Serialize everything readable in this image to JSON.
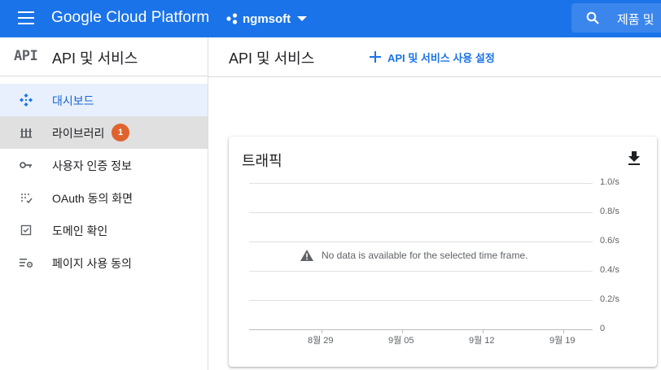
{
  "topbar": {
    "brand": "Google Cloud Platform",
    "project": "ngmsoft",
    "search_text": "제품 및"
  },
  "sidebar": {
    "logo": "API",
    "title": "API 및 서비스",
    "items": [
      {
        "label": "대시보드",
        "icon": "dashboard-icon",
        "active": true
      },
      {
        "label": "라이브러리",
        "icon": "library-icon",
        "badge": "1"
      },
      {
        "label": "사용자 인증 정보",
        "icon": "key-icon"
      },
      {
        "label": "OAuth 동의 화면",
        "icon": "consent-icon"
      },
      {
        "label": "도메인 확인",
        "icon": "checkbox-icon"
      },
      {
        "label": "페이지 사용 동의",
        "icon": "settings-list-icon"
      }
    ]
  },
  "header": {
    "title": "API 및 서비스",
    "enable_label": "API 및 서비스 사용 설정"
  },
  "card": {
    "title": "트래픽",
    "no_data": "No data is available for the selected time frame."
  },
  "chart_data": {
    "type": "line",
    "title": "트래픽",
    "series": [],
    "x_ticks": [
      "8월 29",
      "9월 05",
      "9월 12",
      "9월 19"
    ],
    "y_ticks": [
      "1.0/s",
      "0.8/s",
      "0.6/s",
      "0.4/s",
      "0.2/s",
      "0"
    ],
    "ylim": [
      0,
      1.0
    ],
    "grid": true,
    "message": "No data is available for the selected time frame."
  },
  "colors": {
    "brand_blue": "#1a73e8",
    "badge_orange": "#e0632d",
    "active_bg": "#e8f0fe"
  }
}
